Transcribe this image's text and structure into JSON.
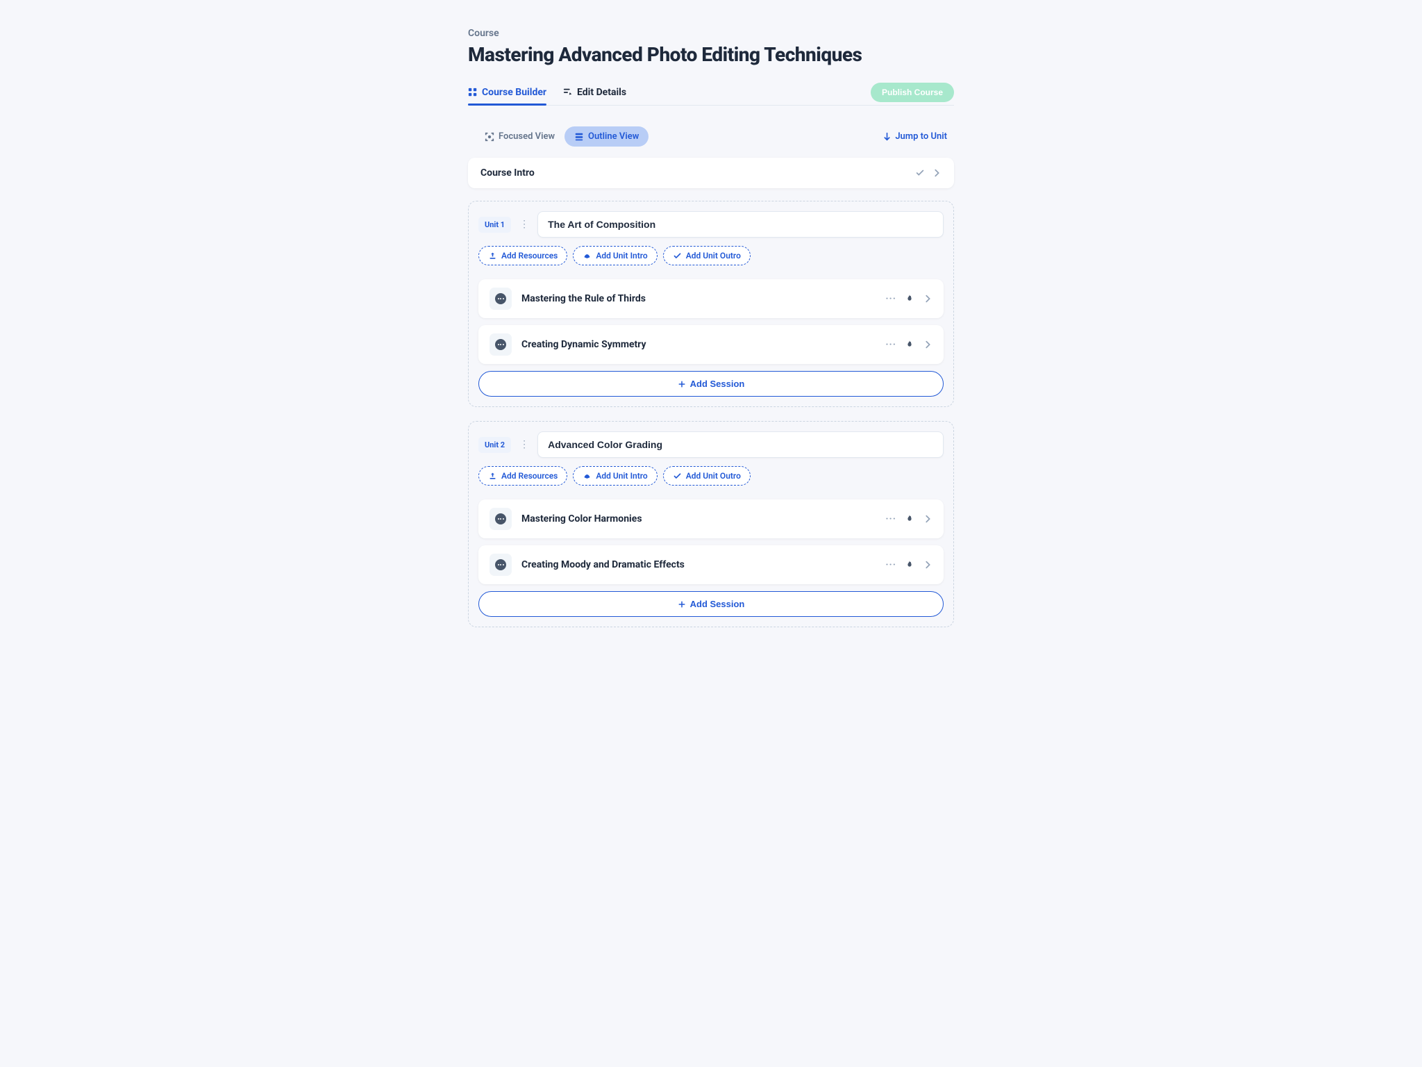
{
  "breadcrumb": "Course",
  "title": "Mastering Advanced Photo Editing Techniques",
  "tabs": {
    "builder": "Course Builder",
    "details": "Edit Details"
  },
  "publish": "Publish Course",
  "views": {
    "focused": "Focused View",
    "outline": "Outline View"
  },
  "jump": "Jump to Unit",
  "intro": {
    "title": "Course Intro"
  },
  "chips": {
    "resources": "Add Resources",
    "intro": "Add Unit Intro",
    "outro": "Add Unit Outro"
  },
  "addSession": "Add Session",
  "units": [
    {
      "badge": "Unit 1",
      "title": "The Art of Composition",
      "sessions": [
        {
          "title": "Mastering the Rule of Thirds"
        },
        {
          "title": "Creating Dynamic Symmetry"
        }
      ]
    },
    {
      "badge": "Unit 2",
      "title": "Advanced Color Grading",
      "sessions": [
        {
          "title": "Mastering Color Harmonies"
        },
        {
          "title": "Creating Moody and Dramatic Effects"
        }
      ]
    }
  ]
}
